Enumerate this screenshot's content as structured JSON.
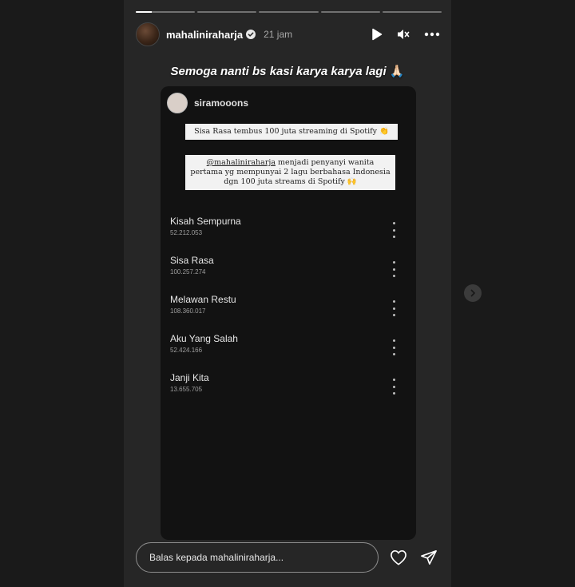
{
  "story": {
    "progress": [
      0.25,
      0,
      0,
      0,
      0
    ],
    "user": {
      "name": "mahalini raharja",
      "username": "mahaliniraharja",
      "time": "21 jam"
    },
    "caption": "Semoga nanti bs kasi karya karya lagi",
    "caption_emoji": "🙏🏻"
  },
  "card": {
    "username": "siramooons",
    "note1": "Sisa Rasa tembus 100 juta streaming di Spotify 👏",
    "note2_mention": "@mahaliniraharja",
    "note2_text": " menjadi penyanyi wanita pertama yg mempunyai 2 lagu berbahasa Indonesia dgn 100 juta streams di Spotify 🙌",
    "tracks": [
      {
        "name": "Kisah Sempurna",
        "plays": "52.212.053"
      },
      {
        "name": "Sisa Rasa",
        "plays": "100.257.274"
      },
      {
        "name": "Melawan Restu",
        "plays": "108.360.017"
      },
      {
        "name": "Aku Yang Salah",
        "plays": "52.424.166"
      },
      {
        "name": "Janji Kita",
        "plays": "13.655.705"
      }
    ]
  },
  "reply": {
    "placeholder": "Balas kepada mahaliniraharja..."
  },
  "icons": {
    "verified": "verified-badge-icon",
    "play": "play-icon",
    "mute": "mute-icon",
    "more": "more-options-icon",
    "heart": "heart-icon",
    "send": "send-icon",
    "next": "chevron-right-icon"
  },
  "colors": {
    "verified": "#ffffff",
    "background": "#1a1a1a",
    "story_bg": "#262626"
  }
}
